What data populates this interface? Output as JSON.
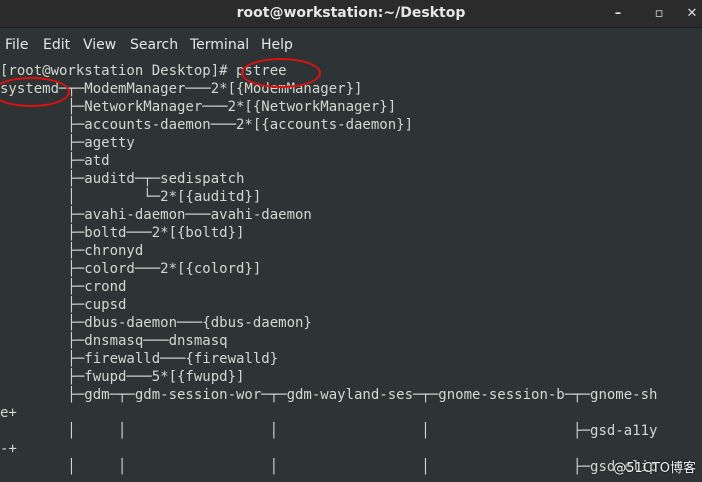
{
  "window": {
    "title": "root@workstation:~/Desktop",
    "minimize_glyph": "–",
    "maximize_glyph": "▫",
    "close_glyph": "✕"
  },
  "menu": [
    "File",
    "Edit",
    "View",
    "Search",
    "Terminal",
    "Help"
  ],
  "terminal": {
    "lines": [
      "[root@workstation Desktop]# pstree",
      "systemd─┬─ModemManager───2*[{ModemManager}]",
      "        ├─NetworkManager───2*[{NetworkManager}]",
      "        ├─accounts-daemon───2*[{accounts-daemon}]",
      "        ├─agetty",
      "        ├─atd",
      "        ├─auditd─┬─sedispatch",
      "        │        └─2*[{auditd}]",
      "        ├─avahi-daemon───avahi-daemon",
      "        ├─boltd───2*[{boltd}]",
      "        ├─chronyd",
      "        ├─colord───2*[{colord}]",
      "        ├─crond",
      "        ├─cupsd",
      "        ├─dbus-daemon───{dbus-daemon}",
      "        ├─dnsmasq───dnsmasq",
      "        ├─firewalld───{firewalld}",
      "        ├─fwupd───5*[{fwupd}]",
      "        ├─gdm─┬─gdm-session-wor─┬─gdm-wayland-ses─┬─gnome-session-b─┬─gnome-sh",
      "e+",
      "        │     │                 │                 │                 ├─gsd-a11y",
      "-+",
      "        │     │                 │                 │                 ├─gsd-clip"
    ]
  },
  "watermark": "@51CTO博客",
  "colors": {
    "background": "#2e3436",
    "text": "#d3d7cf",
    "titlebar": "#2b2b2b",
    "annotation": "#e01010"
  }
}
